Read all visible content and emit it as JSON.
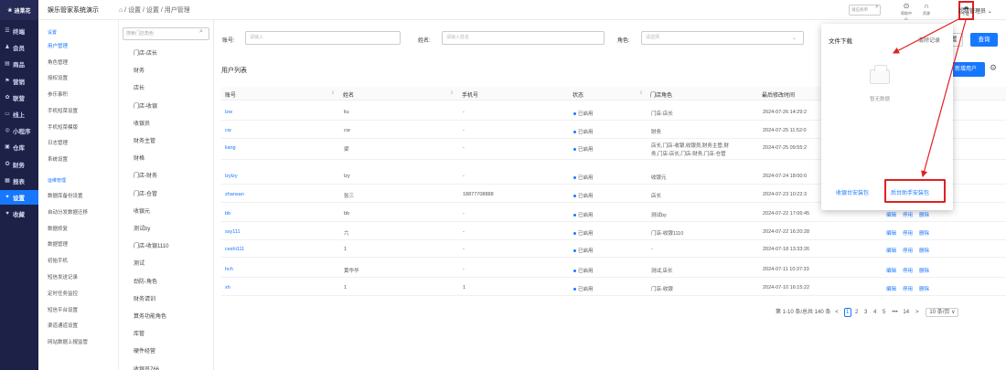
{
  "app": {
    "logo_text": "迪莱花",
    "title": "娱乐管家系统演示",
    "breadcrumb": "⌂ / 设置 / 设置 / 用户管理"
  },
  "topbar": {
    "search_placeholder": "请应商单",
    "help_label": "帮助中心",
    "notice_label": "资源",
    "download_label": "下载",
    "user_name": "超级管理员"
  },
  "sidebar": {
    "items": [
      {
        "label": "终端",
        "icon": "☰"
      },
      {
        "label": "会员",
        "icon": "♟"
      },
      {
        "label": "商品",
        "icon": "▤"
      },
      {
        "label": "营销",
        "icon": "⚑"
      },
      {
        "label": "联营",
        "icon": "✿"
      },
      {
        "label": "线上",
        "icon": "▭"
      },
      {
        "label": "小程序",
        "icon": "◎"
      },
      {
        "label": "仓库",
        "icon": "▣"
      },
      {
        "label": "财务",
        "icon": "✪"
      },
      {
        "label": "报表",
        "icon": "▦"
      },
      {
        "label": "设置",
        "icon": "✦"
      },
      {
        "label": "收藏",
        "icon": "♥"
      }
    ]
  },
  "submenu1": {
    "group1": "设置",
    "items1": [
      "用户管理",
      "角色管理",
      "授权设置",
      "参乐事积",
      "手机短菜设置",
      "手机短菜模版",
      "日志管理",
      "系统设置"
    ],
    "group2": "运维管理",
    "items2": [
      "数据库备份设置",
      "自动分发数据迁移",
      "数据修复",
      "数据管理",
      "初始手机",
      "短信发送记录",
      "定时任务监控",
      "短信平台设置",
      "渠道通道设置",
      "网站数据上报监管"
    ]
  },
  "submenu2": {
    "search_placeholder": "搜索门店角色",
    "items": [
      "门店-店长",
      "财务",
      "店长",
      "门店-收银",
      "收银员",
      "财务主管",
      "财格",
      "门店-财务",
      "门店-仓管",
      "收银元",
      "测试by",
      "门店-收银1110",
      "测试",
      "劲防-角色",
      "财务请训",
      "算务功能角色",
      "库管",
      "硬件经营",
      "收银员766"
    ]
  },
  "filters": {
    "account_label": "账号:",
    "account_placeholder": "请输入",
    "name_label": "姓名:",
    "name_placeholder": "请输入姓名",
    "role_label": "角色:",
    "role_placeholder": "请选择",
    "reset_label": "重置",
    "search_label": "查询"
  },
  "list": {
    "title": "用户列表",
    "add_label": "新增用户",
    "columns": [
      "账号",
      "姓名",
      "手机号",
      "状态",
      "门店角色",
      "最后修改时间"
    ],
    "actions": {
      "edit": "编辑",
      "disable": "停用",
      "delete": "删除"
    },
    "rows": [
      {
        "account": "lzw",
        "name": "liu",
        "phone": "-",
        "status": "已启用",
        "role": "门店-店长",
        "time": "2024-07-26 14:29:2"
      },
      {
        "account": "cw",
        "name": "cw",
        "phone": "-",
        "status": "已启用",
        "role": "财务",
        "time": "2024-07-25 11:52:0"
      },
      {
        "account": "liang",
        "name": "梁",
        "phone": "-",
        "status": "已启用",
        "role": "店长,门店-收银,收银员,财务主管,财",
        "role2": "务,门店-店长,门店-财务,门店-仓管",
        "time": "2024-07-25 09:55:2"
      },
      {
        "account": "lzylzy",
        "name": "lzy",
        "phone": "-",
        "status": "已启用",
        "role": "收银元",
        "time": "2024-07-24 18:00:0"
      },
      {
        "account": "zhansan",
        "name": "张三",
        "phone": "18877708888",
        "status": "已启用",
        "role": "店长",
        "time": "2024-07-23 10:22:3"
      },
      {
        "account": "bb",
        "name": "bb",
        "phone": "-",
        "status": "已启用",
        "role": "测试by",
        "time": "2024-07-22 17:06:45",
        "show_actions": true
      },
      {
        "account": "ssy111",
        "name": "六",
        "phone": "-",
        "status": "已启用",
        "role": "门店-收银1110",
        "time": "2024-07-22 16:20:28",
        "show_actions": true
      },
      {
        "account": "ceshi111",
        "name": "1",
        "phone": "-",
        "status": "已启用",
        "role": "-",
        "time": "2024-07-18 13:33:26",
        "show_actions": true
      },
      {
        "account": "hch",
        "name": "黄华华",
        "phone": "-",
        "status": "已启用",
        "role": "测试,店长",
        "time": "2024-07-11 10:37:33",
        "show_actions": true
      },
      {
        "account": "xh",
        "name": "1",
        "phone": "1",
        "status": "已启用",
        "role": "门店-收银",
        "time": "2024-07-10 16:15:22",
        "show_actions": true
      }
    ]
  },
  "pagination": {
    "summary": "第 1-10 条/总共 140 条",
    "prev": "<",
    "pages": [
      "1",
      "2",
      "3",
      "4",
      "5"
    ],
    "ellipsis": "•••",
    "last": "14",
    "next": ">",
    "page_size": "10 条/页 ∨",
    "current": 1
  },
  "download_panel": {
    "title": "文件下载",
    "clear": "清除记录",
    "empty_text": "暂无数据",
    "cashier_pkg": "收银台安装包",
    "backend_pkg": "后台助手安装包"
  },
  "colors": {
    "sidebar_bg": "#1d2047",
    "accent": "#1677ff",
    "highlight": "#e02020"
  }
}
